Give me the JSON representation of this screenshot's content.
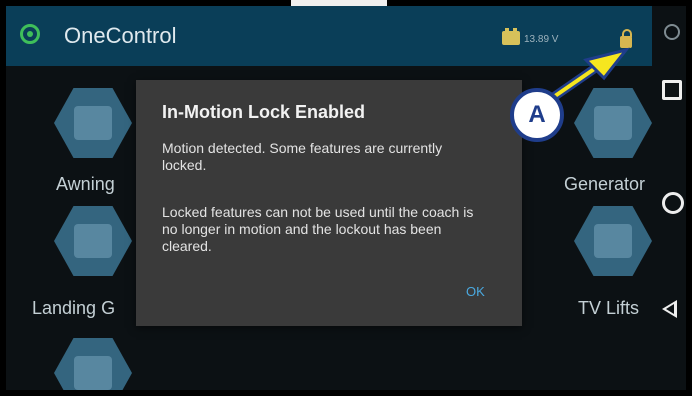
{
  "app": {
    "title": "OneControl"
  },
  "status": {
    "voltage": "13.89 V"
  },
  "tiles": [
    {
      "label": "Awning"
    },
    {
      "label": "Generator"
    },
    {
      "label": "Landing G"
    },
    {
      "label": "TV Lifts"
    }
  ],
  "dialog": {
    "title": "In-Motion Lock Enabled",
    "body1": "Motion detected. Some features are currently locked.",
    "body2": "Locked features can not be used until the coach is no longer in motion and the lockout has been cleared.",
    "ok_label": "OK"
  },
  "callout": {
    "letter": "A"
  },
  "colors": {
    "appbar": "#0a3e58",
    "dialog": "#3a3a3a",
    "callout_border": "#1f3d8b",
    "arrow": "#f6e61f"
  }
}
